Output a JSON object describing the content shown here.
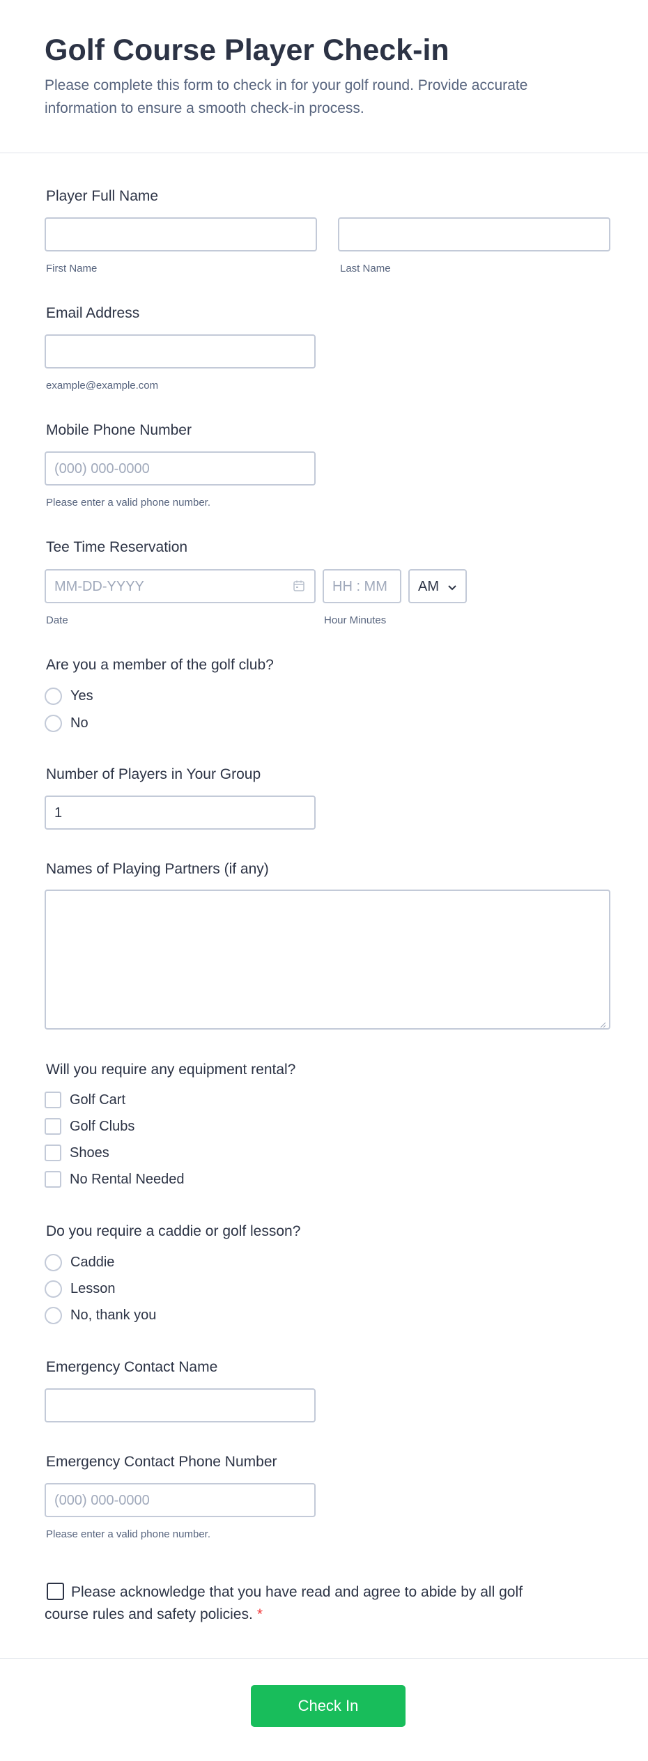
{
  "header": {
    "title": "Golf Course Player Check-in",
    "subtitle": "Please complete this form to check in for your golf round. Provide accurate information to ensure a smooth check-in process."
  },
  "full_name": {
    "label": "Player Full Name",
    "first_sublabel": "First Name",
    "last_sublabel": "Last Name",
    "first_value": "",
    "last_value": ""
  },
  "email": {
    "label": "Email Address",
    "value": "",
    "sublabel": "example@example.com"
  },
  "phone": {
    "label": "Mobile Phone Number",
    "placeholder": "(000) 000-0000",
    "sublabel": "Please enter a valid phone number."
  },
  "tee_time": {
    "label": "Tee Time Reservation",
    "date_placeholder": "MM-DD-YYYY",
    "time_placeholder": "HH : MM",
    "ampm_value": "AM",
    "date_sublabel": "Date",
    "time_sublabel": "Hour Minutes"
  },
  "member": {
    "label": "Are you a member of the golf club?",
    "options": [
      "Yes",
      "No"
    ]
  },
  "num_players": {
    "label": "Number of Players in Your Group",
    "value": "1"
  },
  "partners": {
    "label": "Names of Playing Partners (if any)",
    "value": ""
  },
  "rental": {
    "label": "Will you require any equipment rental?",
    "options": [
      "Golf Cart",
      "Golf Clubs",
      "Shoes",
      "No Rental Needed"
    ]
  },
  "caddie": {
    "label": "Do you require a caddie or golf lesson?",
    "options": [
      "Caddie",
      "Lesson",
      "No, thank you"
    ]
  },
  "emergency_name": {
    "label": "Emergency Contact Name",
    "value": ""
  },
  "emergency_phone": {
    "label": "Emergency Contact Phone Number",
    "placeholder": "(000) 000-0000",
    "sublabel": "Please enter a valid phone number."
  },
  "acknowledge": {
    "text": "Please acknowledge that you have read and agree to abide by all golf course rules and safety policies.",
    "required_mark": "*"
  },
  "submit": {
    "label": "Check In"
  },
  "colors": {
    "accent": "#18bd5b",
    "required": "#f23a3c",
    "border": "#c3cad8",
    "text": "#2c3345",
    "muted": "#57647e"
  },
  "icons": {
    "date": "calendar-icon",
    "select": "chevron-down-icon"
  }
}
